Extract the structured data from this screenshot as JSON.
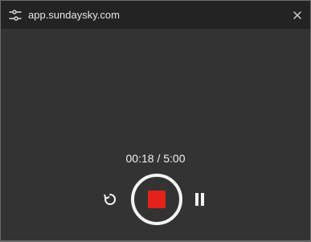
{
  "titlebar": {
    "url": "app.sundaysky.com",
    "site_icon": "settings-sliders-icon",
    "close_icon": "close-icon"
  },
  "recorder": {
    "elapsed": "00:18",
    "separator": " / ",
    "total": "5:00",
    "restart_icon": "restart-icon",
    "stop_icon": "stop-icon",
    "pause_icon": "pause-icon"
  },
  "colors": {
    "background": "#333333",
    "titlebar": "#232323",
    "stop_red": "#e3231b",
    "white": "#f4f4f4"
  }
}
